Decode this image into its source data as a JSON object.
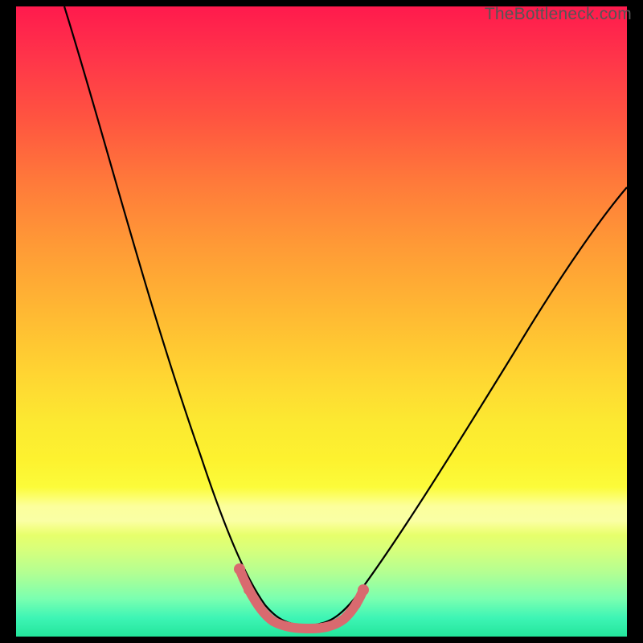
{
  "watermark": "TheBottleneck.com",
  "chart_data": {
    "type": "line",
    "title": "",
    "xlabel": "",
    "ylabel": "",
    "xlim": [
      0,
      100
    ],
    "ylim": [
      0,
      100
    ],
    "grid": false,
    "legend": false,
    "series": [
      {
        "name": "bottleneck-curve",
        "x": [
          8,
          12,
          16,
          20,
          24,
          28,
          32,
          34,
          36,
          38,
          40,
          42,
          44,
          46,
          48,
          50,
          52,
          56,
          60,
          64,
          68,
          72,
          76,
          80,
          84,
          88,
          92,
          96,
          100
        ],
        "y": [
          100,
          90,
          80,
          70,
          60,
          50,
          40,
          33,
          27,
          21,
          15,
          10,
          6,
          4,
          3,
          3,
          4,
          6,
          10,
          15,
          21,
          27,
          33,
          40,
          47,
          54,
          60,
          65,
          68
        ]
      },
      {
        "name": "highlight-segment",
        "x": [
          34,
          36,
          38,
          40,
          42,
          44,
          46,
          48,
          50,
          52
        ],
        "y": [
          33,
          27,
          21,
          15,
          10,
          6,
          4,
          3,
          3,
          4
        ]
      }
    ],
    "gradient_stops": [
      {
        "pos": 0,
        "color": "#ff1a4d"
      },
      {
        "pos": 8,
        "color": "#ff344a"
      },
      {
        "pos": 18,
        "color": "#ff5540"
      },
      {
        "pos": 28,
        "color": "#ff7a3a"
      },
      {
        "pos": 38,
        "color": "#ff9a36"
      },
      {
        "pos": 48,
        "color": "#ffb733"
      },
      {
        "pos": 58,
        "color": "#ffd432"
      },
      {
        "pos": 66,
        "color": "#fce931"
      },
      {
        "pos": 72,
        "color": "#fdf22f"
      },
      {
        "pos": 78,
        "color": "#fbff3e"
      },
      {
        "pos": 82,
        "color": "#f3ff5e"
      },
      {
        "pos": 86,
        "color": "#d9ff7a"
      },
      {
        "pos": 90,
        "color": "#b2ff93"
      },
      {
        "pos": 94,
        "color": "#7affb0"
      },
      {
        "pos": 97,
        "color": "#3ef5b5"
      },
      {
        "pos": 100,
        "color": "#23e59b"
      }
    ],
    "highlight_color": "#d96a6f"
  }
}
